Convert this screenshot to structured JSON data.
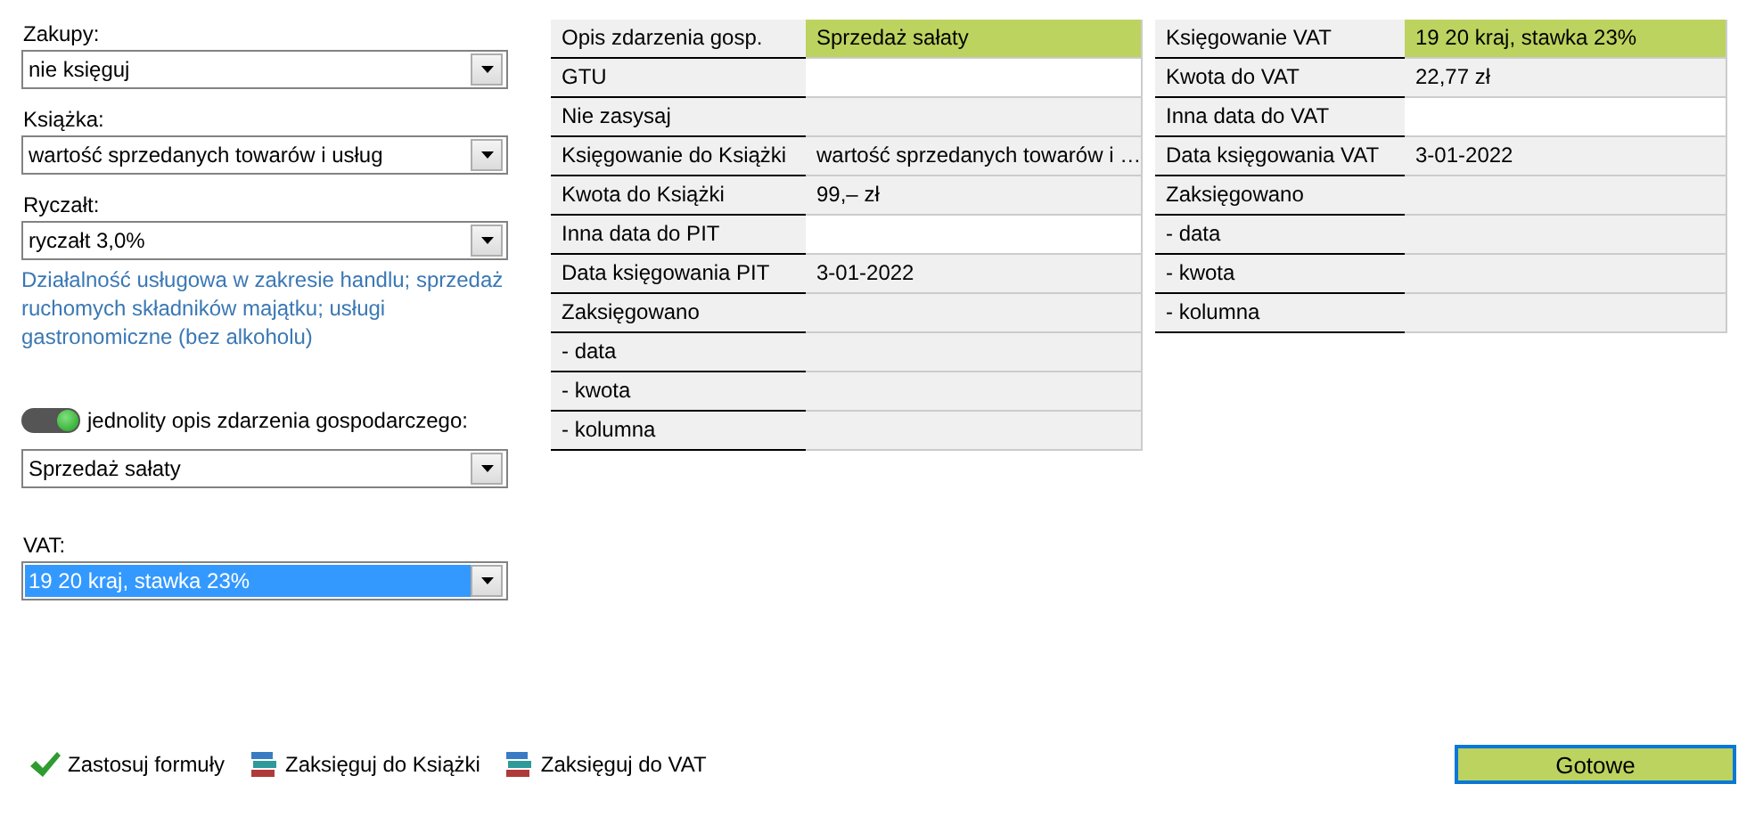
{
  "form": {
    "fields": [
      {
        "kind": "select",
        "label": "Zakupy:",
        "value": "nie księguj",
        "selected": false
      },
      {
        "kind": "select",
        "label": "Książka:",
        "value": "wartość sprzedanych towarów i usług",
        "selected": false
      },
      {
        "kind": "select",
        "label": "Ryczałt:",
        "value": "ryczałt 3,0%",
        "selected": false,
        "note": "Działalność usługowa w zakresie handlu; sprzedaż ruchomych składników majątku; usługi gastronomiczne (bez alkoholu)"
      },
      {
        "kind": "toggle",
        "label": "jednolity opis zdarzenia gospodarczego:",
        "on": true,
        "value": "Sprzedaż sałaty",
        "selected": false
      },
      {
        "kind": "select",
        "label": "VAT:",
        "value": "19 20 kraj, stawka 23%",
        "selected": true
      }
    ]
  },
  "tables": [
    {
      "rows": [
        {
          "label": "Opis zdarzenia gosp.",
          "value": "Sprzedaż sałaty",
          "kind": "highlight"
        },
        {
          "label": "GTU",
          "kind": "input"
        },
        {
          "label": "Nie zasysaj",
          "kind": "plain"
        },
        {
          "label": "Księgowanie do Książki",
          "value": "wartość sprzedanych towarów i …",
          "kind": "plain"
        },
        {
          "label": "Kwota do Książki",
          "value": "99,– zł",
          "kind": "plain"
        },
        {
          "label": "Inna data do PIT",
          "kind": "input"
        },
        {
          "label": "Data księgowania PIT",
          "value": "3-01-2022",
          "kind": "plain"
        },
        {
          "label": "Zaksięgowano",
          "kind": "plain"
        },
        {
          "label": "- data",
          "kind": "plain"
        },
        {
          "label": "- kwota",
          "kind": "plain"
        },
        {
          "label": "- kolumna",
          "kind": "plain"
        }
      ]
    },
    {
      "rows": [
        {
          "label": "Księgowanie VAT",
          "value": "19 20 kraj, stawka 23%",
          "kind": "highlight"
        },
        {
          "label": "Kwota do VAT",
          "value": "22,77 zł",
          "kind": "plain"
        },
        {
          "label": "Inna data do VAT",
          "kind": "input"
        },
        {
          "label": "Data księgowania VAT",
          "value": "3-01-2022",
          "kind": "plain"
        },
        {
          "label": "Zaksięgowano",
          "kind": "plain"
        },
        {
          "label": "- data",
          "kind": "plain"
        },
        {
          "label": "- kwota",
          "kind": "plain"
        },
        {
          "label": "- kolumna",
          "kind": "plain"
        }
      ]
    }
  ],
  "actions": [
    {
      "kind": "check",
      "label": "Zastosuj formuły"
    },
    {
      "kind": "books",
      "label": "Zaksięguj do Książki"
    },
    {
      "kind": "books",
      "label": "Zaksięguj do VAT"
    }
  ],
  "done_button": "Gotowe"
}
